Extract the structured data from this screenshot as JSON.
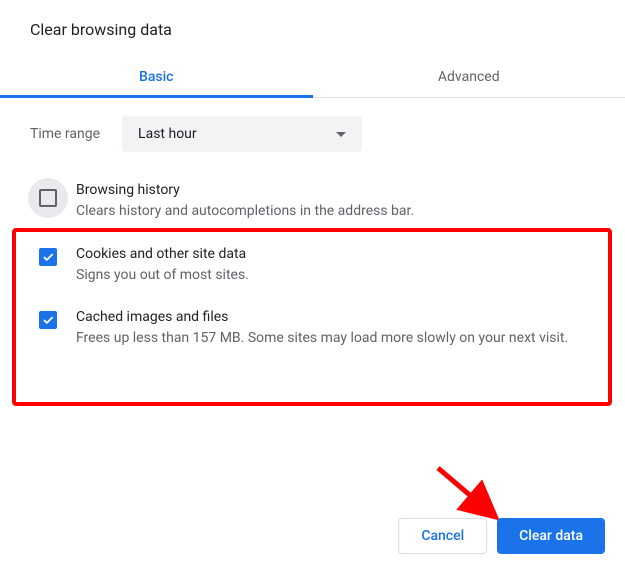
{
  "title": "Clear browsing data",
  "tabs": {
    "basic": "Basic",
    "advanced": "Advanced"
  },
  "timeRange": {
    "label": "Time range",
    "value": "Last hour"
  },
  "options": [
    {
      "title": "Browsing history",
      "desc": "Clears history and autocompletions in the address bar.",
      "checked": false
    },
    {
      "title": "Cookies and other site data",
      "desc": "Signs you out of most sites.",
      "checked": true
    },
    {
      "title": "Cached images and files",
      "desc": "Frees up less than 157 MB. Some sites may load more slowly on your next visit.",
      "checked": true
    }
  ],
  "buttons": {
    "cancel": "Cancel",
    "clear": "Clear data"
  }
}
